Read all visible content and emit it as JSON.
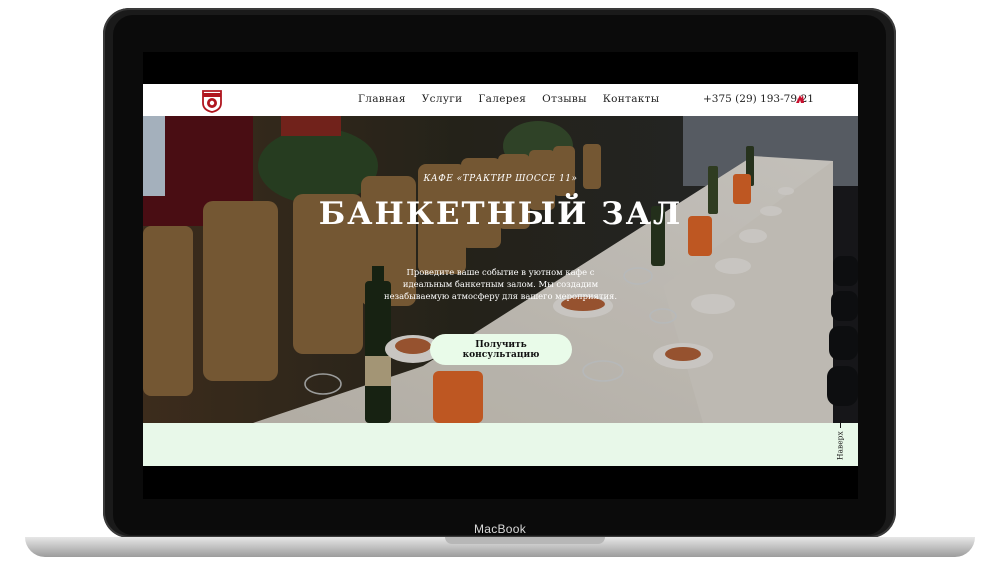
{
  "device": {
    "label": "MacBook"
  },
  "site": {
    "logo_name": "traktir-logo",
    "nav": [
      {
        "label": "Главная"
      },
      {
        "label": "Услуги"
      },
      {
        "label": "Галерея"
      },
      {
        "label": "Отзывы"
      },
      {
        "label": "Контакты"
      }
    ],
    "phone": "+375 (29) 193-79-21",
    "phone_icon": "phone-operator-icon"
  },
  "hero": {
    "eyebrow": "КАФЕ «ТРАКТИР ШОССЕ 11»",
    "title": "БАНКЕТНЫЙ ЗАЛ",
    "description": "Проведите ваше событие в уютном кафе с идеальным банкетным залом. Мы создадим незабываемую атмосферу для вашего мероприятия.",
    "cta_label": "Получить консультацию"
  },
  "back_to_top": {
    "label": "Наверх"
  },
  "colors": {
    "accent": "#e8f8e9",
    "nav_text": "#222222",
    "hero_text": "#ffffff",
    "phone_icon": "#c8102e"
  }
}
